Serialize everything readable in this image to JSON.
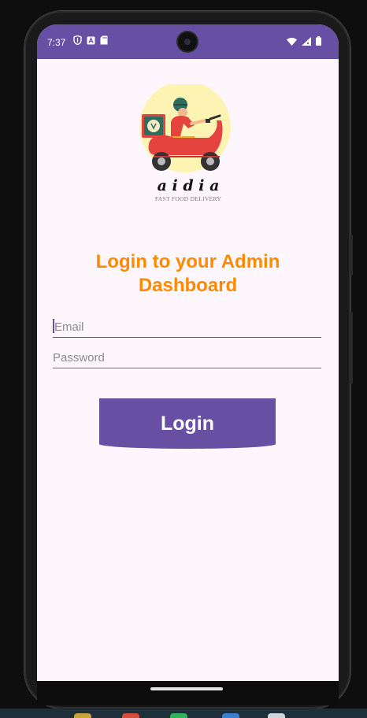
{
  "status_bar": {
    "time": "7:37",
    "left_icons": [
      "shield-icon",
      "a-badge-icon",
      "sd-card-icon"
    ],
    "right_icons": [
      "wifi-icon",
      "signal-icon",
      "battery-icon"
    ],
    "background": "#6750a4"
  },
  "logo": {
    "brand_name": "a i d i a",
    "tagline": "FAST FOOD DELIVERY",
    "icon": "delivery-scooter-icon"
  },
  "login": {
    "title_line1": "Login to your Admin",
    "title_line2": "Dashboard",
    "title_color": "#ff8a00",
    "email_placeholder": "Email",
    "password_placeholder": "Password",
    "button_label": "Login",
    "button_color": "#6750a4"
  },
  "colors": {
    "screen_background": "#fdf7fd",
    "accent": "#6750a4"
  }
}
